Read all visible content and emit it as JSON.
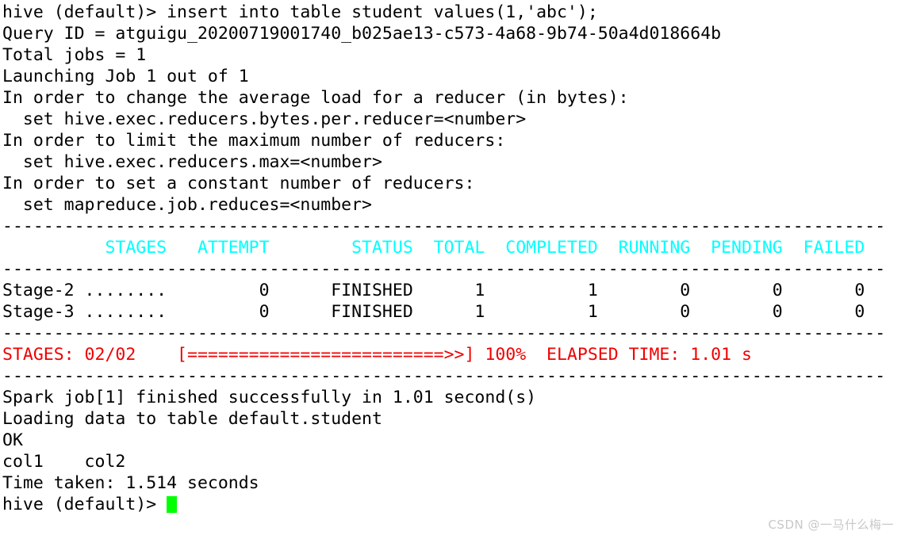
{
  "terminal": {
    "prompt": "hive (default)> ",
    "colors": {
      "background": "#ffffff",
      "foreground": "#000000",
      "header_cyan": "#00ffff",
      "progress_red": "#f00000",
      "cursor_green": "#00ff00",
      "watermark_gray": "#c8c8c8"
    },
    "lines": {
      "l01_command": "hive (default)> insert into table student values(1,'abc');",
      "l02_query_id": "Query ID = atguigu_20200719001740_b025ae13-c573-4a68-9b74-50a4d018664b",
      "l03_total_jobs": "Total jobs = 1",
      "l04_launching": "Launching Job 1 out of 1",
      "l05_order_avg_load": "In order to change the average load for a reducer (in bytes):",
      "l06_set_bytes_per_reducer": "  set hive.exec.reducers.bytes.per.reducer=<number>",
      "l07_order_limit_max": "In order to limit the maximum number of reducers:",
      "l08_set_reducers_max": "  set hive.exec.reducers.max=<number>",
      "l09_order_constant": "In order to set a constant number of reducers:",
      "l10_set_job_reduces": "  set mapreduce.job.reduces=<number>",
      "l11_divider": "--------------------------------------------------------------------------------------",
      "l12_table_header": "          STAGES   ATTEMPT        STATUS  TOTAL  COMPLETED  RUNNING  PENDING  FAILED",
      "l13_divider": "--------------------------------------------------------------------------------------",
      "l14_stage2": "Stage-2 ........         0      FINISHED      1          1        0        0       0",
      "l15_stage3": "Stage-3 ........         0      FINISHED      1          1        0        0       0",
      "l16_divider": "--------------------------------------------------------------------------------------",
      "l17_progress": "STAGES: 02/02    [=========================>>] 100%  ELAPSED TIME: 1.01 s",
      "l18_divider": "--------------------------------------------------------------------------------------",
      "l19_spark_done": "Spark job[1] finished successfully in 1.01 second(s)",
      "l20_loading": "Loading data to table default.student",
      "l21_ok": "OK",
      "l22_cols": "col1    col2",
      "l23_time_taken": "Time taken: 1.514 seconds",
      "l24_prompt": "hive (default)> "
    },
    "table": {
      "headers": [
        "STAGES",
        "ATTEMPT",
        "STATUS",
        "TOTAL",
        "COMPLETED",
        "RUNNING",
        "PENDING",
        "FAILED"
      ],
      "rows": [
        [
          "Stage-2 ........",
          "0",
          "FINISHED",
          "1",
          "1",
          "0",
          "0",
          "0"
        ],
        [
          "Stage-3 ........",
          "0",
          "FINISHED",
          "1",
          "1",
          "0",
          "0",
          "0"
        ]
      ]
    },
    "progress": {
      "stages_label": "STAGES: 02/02",
      "bar": "[=========================>>]",
      "percent": "100%",
      "elapsed_label": "ELAPSED TIME:",
      "elapsed_value": "1.01 s"
    },
    "result_columns": [
      "col1",
      "col2"
    ],
    "watermark": "CSDN @一马什么梅一"
  }
}
